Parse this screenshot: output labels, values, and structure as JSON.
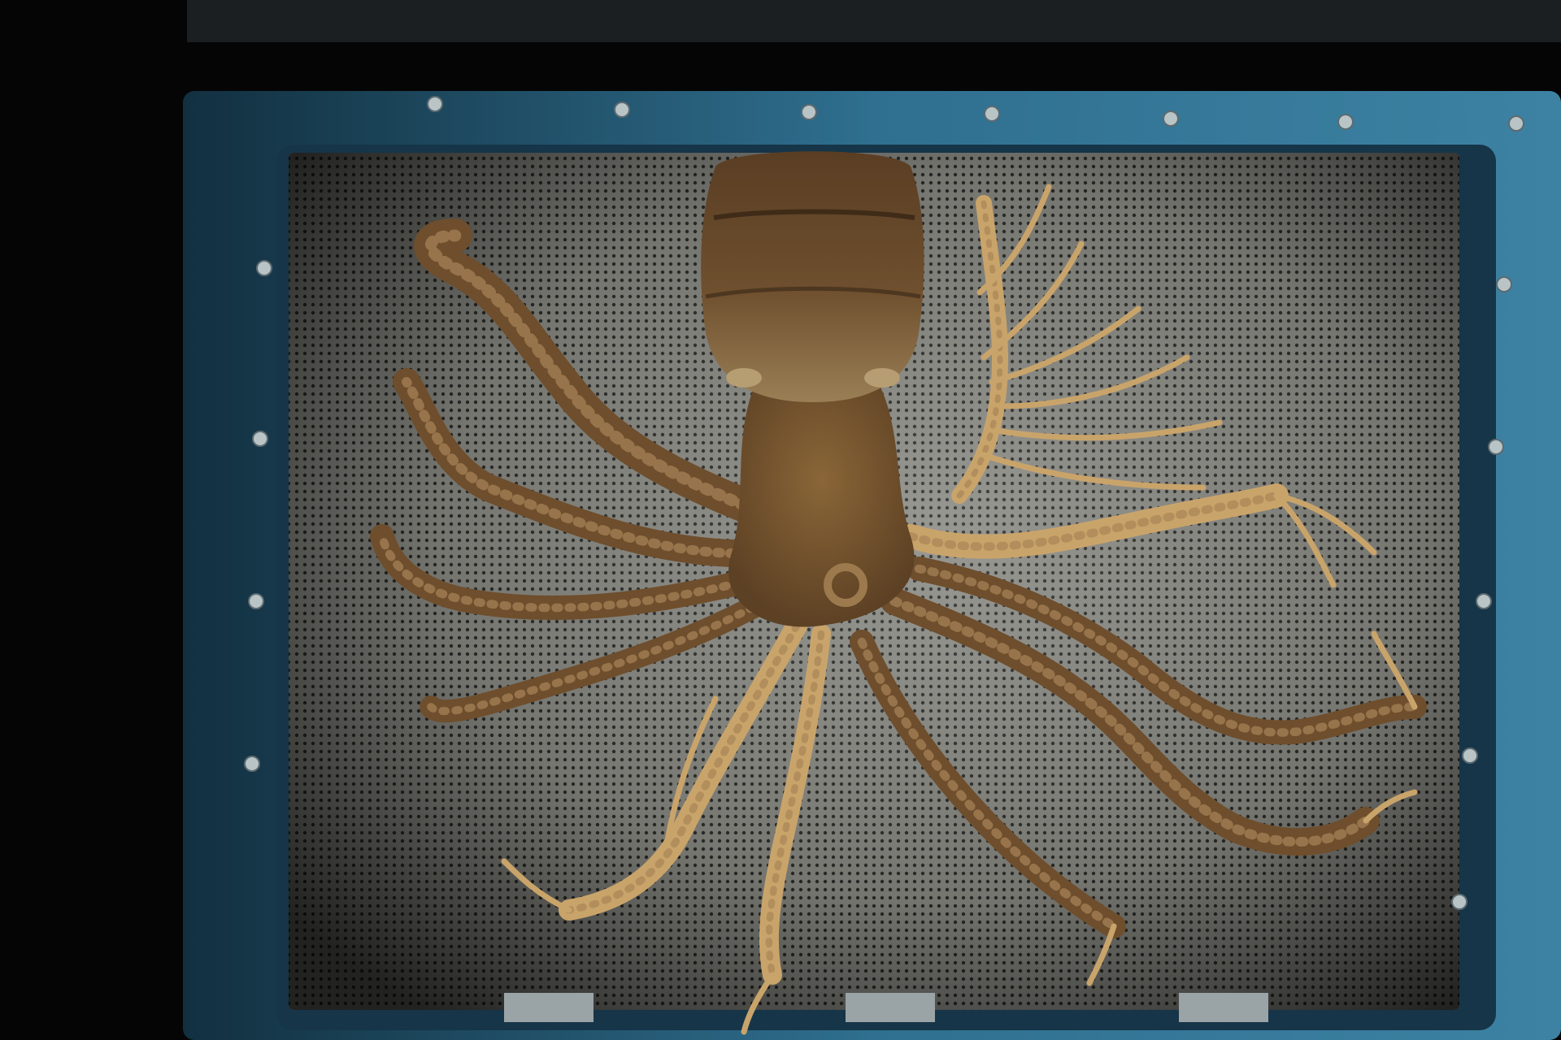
{
  "scene": {
    "subject": "octopus-specimen",
    "colors": {
      "background": "#050505",
      "frame": "#2f6f8f",
      "frame_shadow": "#163548",
      "panel": "#8a8a84",
      "panel_dots": "#2c2c2a",
      "mantle": "#6b4a2a",
      "body": "#7a5630",
      "arm_dark": "#6e4e2c",
      "arm_light": "#c9a46a",
      "sucker": "#a88558",
      "screw": "#b9c4c7"
    }
  }
}
